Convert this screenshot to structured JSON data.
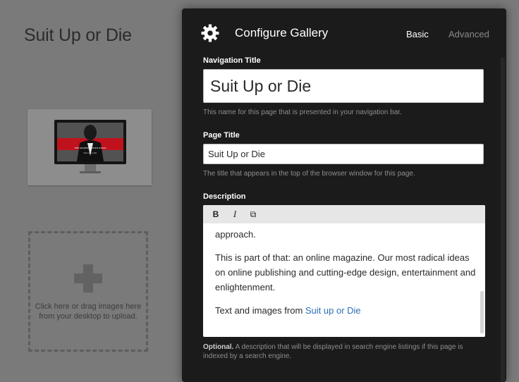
{
  "background": {
    "page_title": "Suit Up or Die",
    "upload_hint": "Click here or drag images here from your desktop to upload."
  },
  "thumbnail": {
    "header_text": "THE MODERN GENTLEMAN",
    "subtitle_text": "Suit Up or Die"
  },
  "modal": {
    "title": "Configure Gallery",
    "tabs": [
      {
        "label": "Basic",
        "active": true
      },
      {
        "label": "Advanced",
        "active": false
      }
    ],
    "navigation_title": {
      "label": "Navigation Title",
      "value": "Suit Up or Die",
      "help": "This name for this page that is presented in your navigation bar."
    },
    "page_title": {
      "label": "Page Title",
      "value": "Suit Up or Die",
      "help": "The title that appears in the top of the browser window for this page."
    },
    "description": {
      "label": "Description",
      "toolbar": {
        "bold": "B",
        "italic": "I",
        "link": "⧉"
      },
      "paragraph1": "approach.",
      "paragraph2": "This is part of that: an online magazine. Our most radical ideas on online publishing and cutting-edge design, entertainment and enlightenment.",
      "paragraph3_prefix": "Text and images from ",
      "paragraph3_link": "Suit up or Die"
    },
    "optional_label": "Optional.",
    "optional_text": " A description that will be displayed in search engine listings if this page is indexed by a search engine."
  },
  "colors": {
    "overlay": "#7a7a7a",
    "modal_bg": "#1b1b1b",
    "link": "#2c6fb5",
    "thumbnail_accent": "#c0121c"
  }
}
